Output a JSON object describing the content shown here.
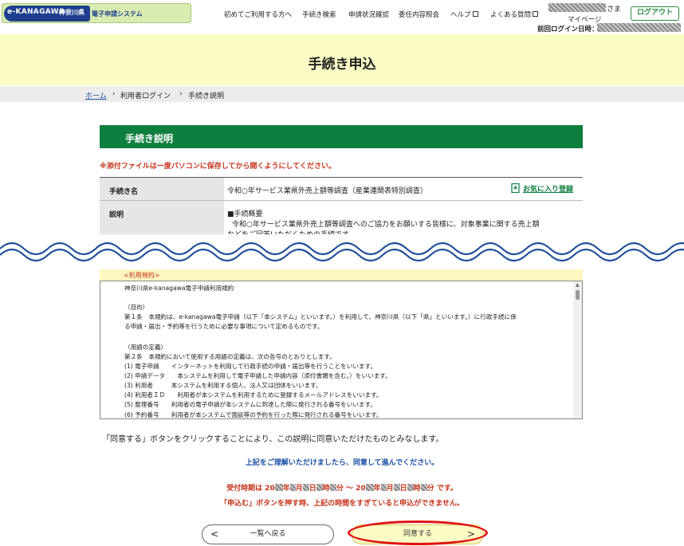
{
  "header": {
    "logo": {
      "brand": "e-KANAGAWA",
      "prefecture": "神奈川県",
      "system": "電子申請システム"
    },
    "nav": [
      "初めてご利用する方へ",
      "手続き検索",
      "申請状況確認",
      "委任内容照会",
      "ヘルプ",
      "よくある質問"
    ],
    "user_suffix": "さま",
    "mypage": "マイページ",
    "last_login_label": "前回ログイン日時：",
    "logout": "ログアウト"
  },
  "banner": {
    "title": "手続き申込"
  },
  "breadcrumb": {
    "home": "ホーム",
    "sep": "›",
    "items": [
      "利用者ログイン",
      "手続き説明"
    ]
  },
  "section": {
    "title": "手続き説明"
  },
  "warning": "※添付ファイルは一度パソコンに保存してから開くようにしてください。",
  "details": {
    "name_label": "手続き名",
    "name_value": "令和○年サービス業県外売上額等調査（産業連関表特別調査）",
    "favorite": "お気に入り登録",
    "desc_label": "説明",
    "desc_lines": [
      "■手続概要",
      "令和○年サービス業県外売上額等調査へのご協力をお願いする皆様に、対象事業に関する売上額",
      "などをご回答いただくための手続です。"
    ]
  },
  "terms": {
    "header": "<利用規約>",
    "lines": [
      "神奈川県e-kanagawa電子申請利用規約",
      "",
      "（目的）",
      "第１条　本規約は、e-kanagawa電子申請（以下「本システム」といいます。）を利用して、神奈川県（以下「県」といいます。）に行政手続に係",
      "る申請・届出・予約等を行うために必要な事項について定めるものです。",
      "",
      "（用語の定義）",
      "第２条　本規約において使用する用語の定義は、次の各号のとおりとします。",
      "(1) 電子申請　　インターネットを利用して行政手続の申請・届出等を行うことをいいます。",
      "(2) 申請データ　　本システムを利用して電子申請した申請内容（添付書類を含む。）をいいます。",
      "(3) 利用者　　　本システムを利用する個人、法人又は団体をいいます。",
      "(4) 利用者ＩＤ　　利用者が本システムを利用するために登録するメールアドレスをいいます。",
      "(5) 整理番号　　利用者の電子申請が本システムに到達した際に発行される番号をいいます。",
      "(6) 予約番号　　利用者が本システムで面談等の予約を行った際に発行される番号をいいます。"
    ]
  },
  "agree_text": "「同意する」ボタンをクリックすることにより、この説明に同意いただけたものとみなします。",
  "notice_blue": "上記をご理解いただけましたら、同意して進んでください。",
  "reception_prefix": "受付時期は 20",
  "reception_parts": [
    "年",
    "月",
    "日",
    "時",
    "分 ～ 20",
    "年",
    "月",
    "日",
    "時",
    "分 です。"
  ],
  "notice_red2": "「申込む」ボタンを押す時、上記の時間をすぎていると申込ができません。",
  "buttons": {
    "back": "一覧へ戻る",
    "agree": "同意する",
    "back_chev": "<",
    "agree_chev": ">"
  },
  "colors": {
    "green": "#0d7f3f",
    "banner": "#fdfbc4",
    "red": "#c4331a",
    "blue": "#1a4fa6",
    "highlight": "#e01111"
  }
}
